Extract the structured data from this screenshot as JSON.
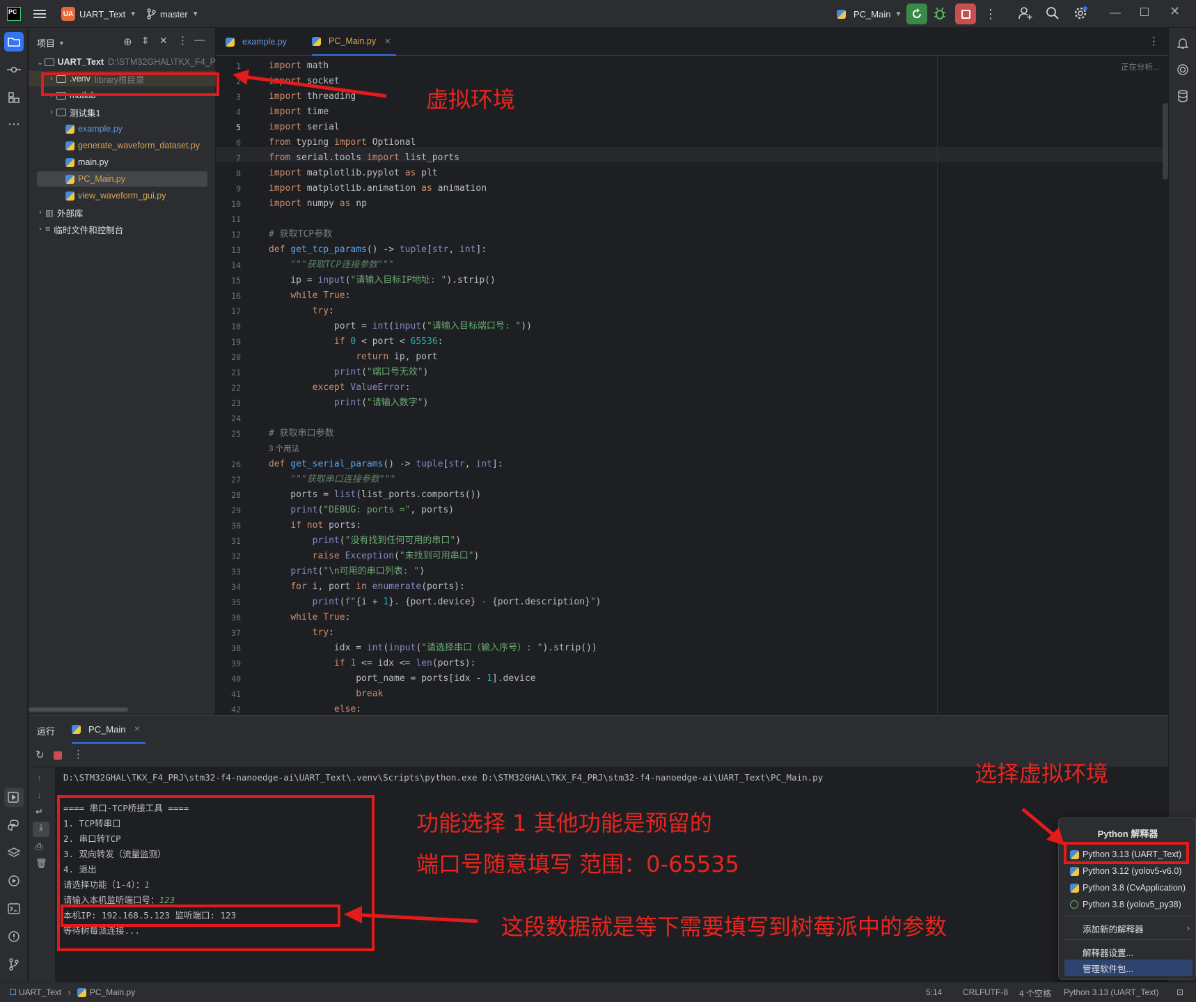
{
  "titlebar": {
    "logo_text": "PC",
    "project_badge": "UA",
    "project_name": "UART_Text",
    "branch": "master",
    "run_config": "PC_Main"
  },
  "project_panel": {
    "title": "项目",
    "tree": [
      {
        "label": "UART_Text",
        "hint": "D:\\STM32GHAL\\TKX_F4_P",
        "type": "root"
      },
      {
        "label": ".venv",
        "hint": "library根目录",
        "type": "folder"
      },
      {
        "label": "matlab",
        "type": "folder"
      },
      {
        "label": "测试集1",
        "type": "folder"
      },
      {
        "label": "example.py",
        "type": "py"
      },
      {
        "label": "generate_waveform_dataset.py",
        "type": "py"
      },
      {
        "label": "main.py",
        "type": "py"
      },
      {
        "label": "PC_Main.py",
        "type": "py"
      },
      {
        "label": "view_waveform_gui.py",
        "type": "py"
      },
      {
        "label": "外部库",
        "type": "lib"
      },
      {
        "label": "临时文件和控制台",
        "type": "scratch"
      }
    ]
  },
  "editor": {
    "tabs": [
      {
        "label": "example.py"
      },
      {
        "label": "PC_Main.py"
      }
    ],
    "analysis_hint": "正在分析...",
    "usage_hint": "3 个用法",
    "line_numbers": [
      "1",
      "2",
      "3",
      "4",
      "5",
      "6",
      "7",
      "8",
      "9",
      "10",
      "11",
      "12",
      "13",
      "14",
      "15",
      "16",
      "17",
      "18",
      "19",
      "20",
      "21",
      "22",
      "23",
      "24",
      "25",
      "26",
      "27",
      "28",
      "29",
      "30",
      "31",
      "32",
      "33",
      "34",
      "35",
      "36",
      "37",
      "38",
      "39",
      "40",
      "41",
      "42"
    ]
  },
  "run_panel": {
    "title": "运行",
    "tab": "PC_Main",
    "console": [
      "D:\\STM32GHAL\\TKX_F4_PRJ\\stm32-f4-nanoedge-ai\\UART_Text\\.venv\\Scripts\\python.exe D:\\STM32GHAL\\TKX_F4_PRJ\\stm32-f4-nanoedge-ai\\UART_Text\\PC_Main.py",
      "",
      "==== 串口-TCP桥接工具 ====",
      "1. TCP转串口",
      "2. 串口转TCP",
      "3. 双向转发（流量监测）",
      "4. 退出",
      "请选择功能（1-4）：",
      "请输入本机监听端口号：",
      "本机IP: 192.168.5.123 监听端口: 123",
      "等待树莓派连接..."
    ],
    "input_1": "1",
    "input_2": "123"
  },
  "popup": {
    "title": "Python 解释器",
    "items": [
      "Python 3.13 (UART_Text)",
      "Python 3.12 (yolov5-v6.0)",
      "Python 3.8 (CvApplication)",
      "Python 3.8 (yolov5_py38)"
    ],
    "add": "添加新的解释器",
    "settings": "解释器设置...",
    "manage": "管理软件包..."
  },
  "annotations": {
    "venv": "虚拟环境",
    "select_venv": "选择虚拟环境",
    "func_select": "功能选择 1   其他功能是预留的",
    "port_range": "端口号随意填写  范围：0-65535",
    "data_note": "这段数据就是等下需要填写到树莓派中的参数"
  },
  "statusbar": {
    "breadcrumb_project": "UART_Text",
    "breadcrumb_file": "PC_Main.py",
    "position": "5:14",
    "line_sep": "CRLF",
    "encoding": "UTF-8",
    "indent": "4 个空格",
    "interpreter": "Python 3.13 (UART_Text)"
  },
  "colors": {
    "accent": "#3574f0",
    "annotation_red": "#e21b1b",
    "run_green": "#3a8a47",
    "stop_red": "#c94f4f"
  }
}
